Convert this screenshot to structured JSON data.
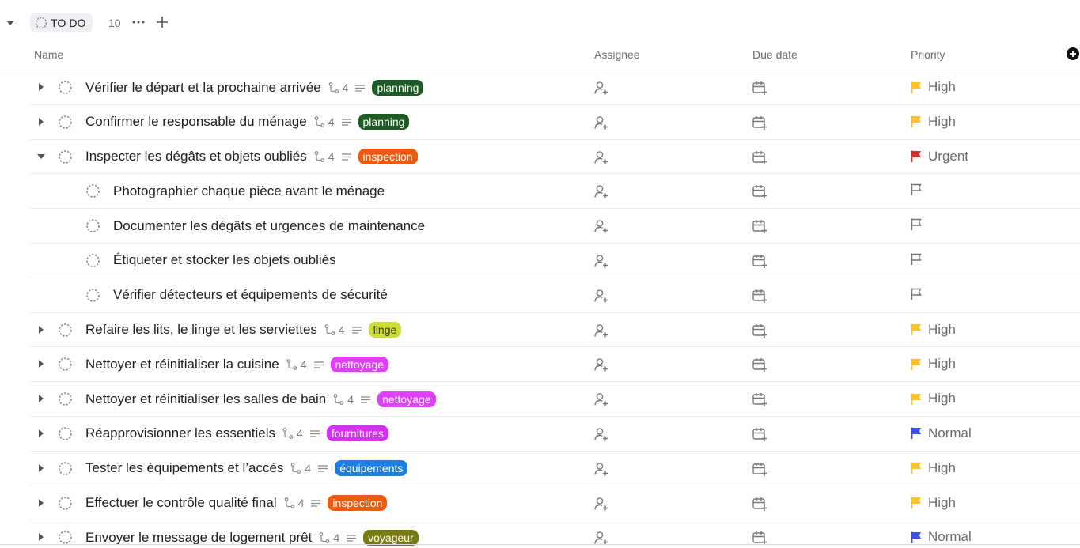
{
  "group": {
    "status_label": "TO DO",
    "count": "10"
  },
  "columns": {
    "name": "Name",
    "assignee": "Assignee",
    "due_date": "Due date",
    "priority": "Priority"
  },
  "colors": {
    "high": "#fbc02d",
    "urgent": "#d32f2f",
    "normal": "#3f51e0",
    "tag_planning": "#1e5a24",
    "tag_inspection": "#ef5a0f",
    "tag_linge": "#cddc39",
    "tag_nettoyage": "#e040fb",
    "tag_fournitures": "#d62ef5",
    "tag_equipements": "#1e7fe0",
    "tag_voyageur": "#7a7a12"
  },
  "tasks": [
    {
      "name": "Vérifier le départ et la prochaine arrivée",
      "subtasks": "4",
      "tag": "planning",
      "priority": "High"
    },
    {
      "name": "Confirmer le responsable du ménage",
      "subtasks": "4",
      "tag": "planning",
      "priority": "High"
    },
    {
      "name": "Inspecter les dégâts et objets oubliés",
      "subtasks": "4",
      "tag": "inspection",
      "priority": "Urgent"
    },
    {
      "name": "Photographier chaque pièce avant le ménage"
    },
    {
      "name": "Documenter les dégâts et urgences de maintenance"
    },
    {
      "name": "Étiqueter et stocker les objets oubliés"
    },
    {
      "name": "Vérifier détecteurs et équipements de sécurité"
    },
    {
      "name": "Refaire les lits, le linge et les serviettes",
      "subtasks": "4",
      "tag": "linge",
      "priority": "High"
    },
    {
      "name": "Nettoyer et réinitialiser la cuisine",
      "subtasks": "4",
      "tag": "nettoyage",
      "priority": "High"
    },
    {
      "name": "Nettoyer et réinitialiser les salles de bain",
      "subtasks": "4",
      "tag": "nettoyage",
      "priority": "High"
    },
    {
      "name": "Réapprovisionner les essentiels",
      "subtasks": "4",
      "tag": "fournitures",
      "priority": "Normal"
    },
    {
      "name": "Tester les équipements et l’accès",
      "subtasks": "4",
      "tag": "équipements",
      "priority": "High"
    },
    {
      "name": "Effectuer le contrôle qualité final",
      "subtasks": "4",
      "tag": "inspection",
      "priority": "High"
    },
    {
      "name": "Envoyer le message de logement prêt",
      "subtasks": "4",
      "tag": "voyageur",
      "priority": "Normal"
    }
  ]
}
